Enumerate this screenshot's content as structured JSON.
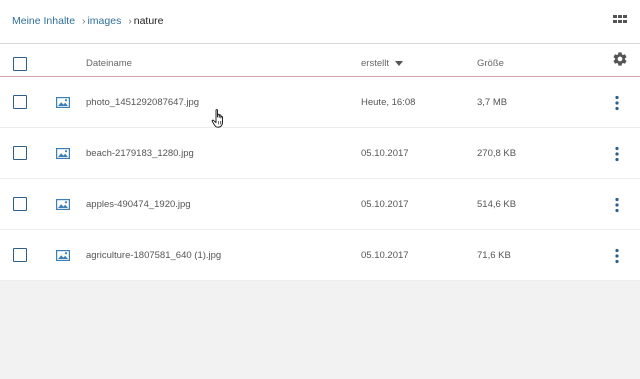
{
  "breadcrumb": {
    "root": "Meine Inhalte",
    "separator": "›",
    "level1": "images",
    "current": "nature"
  },
  "toolbar": {
    "view_toggle_icon": "grid-view-icon",
    "settings_icon": "gear-icon"
  },
  "table": {
    "headers": {
      "name": "Dateiname",
      "created": "erstellt",
      "size": "Größe"
    },
    "sort": {
      "column": "created",
      "direction": "descending"
    },
    "rows": [
      {
        "name": "photo_1451292087647.jpg",
        "created": "Heute, 16:08",
        "size": "3,7 MB"
      },
      {
        "name": "beach-2179183_1280.jpg",
        "created": "05.10.2017",
        "size": "270,8 KB"
      },
      {
        "name": "apples-490474_1920.jpg",
        "created": "05.10.2017",
        "size": "514,6 KB"
      },
      {
        "name": "agriculture-1807581_640 (1).jpg",
        "created": "05.10.2017",
        "size": "71,6 KB"
      }
    ]
  },
  "colors": {
    "link": "#2f6f9a",
    "checkbox_border": "#2e5f88",
    "icon_blue": "#3d7fb5",
    "header_divider": "#cfa7a7"
  }
}
